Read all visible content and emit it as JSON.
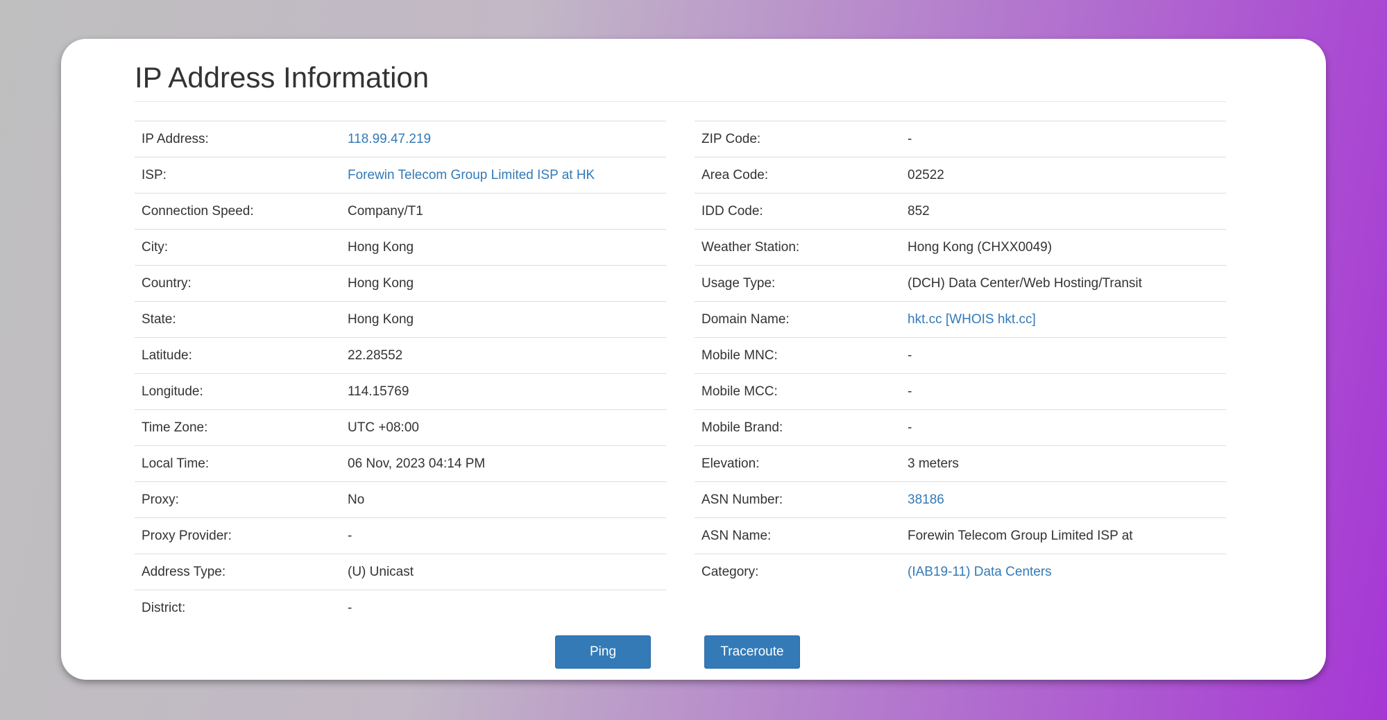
{
  "title": "IP Address Information",
  "left_rows": [
    {
      "label": "IP Address:",
      "value": "118.99.47.219",
      "link": true
    },
    {
      "label": "ISP:",
      "value": "Forewin Telecom Group Limited ISP at HK",
      "link": true
    },
    {
      "label": "Connection Speed:",
      "value": "Company/T1",
      "link": false
    },
    {
      "label": "City:",
      "value": "Hong Kong",
      "link": false
    },
    {
      "label": "Country:",
      "value": "Hong Kong",
      "link": false
    },
    {
      "label": "State:",
      "value": "Hong Kong",
      "link": false
    },
    {
      "label": "Latitude:",
      "value": "22.28552",
      "link": false
    },
    {
      "label": "Longitude:",
      "value": "114.15769",
      "link": false
    },
    {
      "label": "Time Zone:",
      "value": "UTC +08:00",
      "link": false
    },
    {
      "label": "Local Time:",
      "value": "06 Nov, 2023 04:14 PM",
      "link": false
    },
    {
      "label": "Proxy:",
      "value": "No",
      "link": false
    },
    {
      "label": "Proxy Provider:",
      "value": "-",
      "link": false
    },
    {
      "label": "Address Type:",
      "value": "(U) Unicast",
      "link": false
    },
    {
      "label": "District:",
      "value": "-",
      "link": false
    }
  ],
  "right_rows": [
    {
      "label": "ZIP Code:",
      "value": "-",
      "link": false
    },
    {
      "label": "Area Code:",
      "value": "02522",
      "link": false
    },
    {
      "label": "IDD Code:",
      "value": "852",
      "link": false
    },
    {
      "label": "Weather Station:",
      "value": "Hong Kong (CHXX0049)",
      "link": false
    },
    {
      "label": "Usage Type:",
      "value": "(DCH) Data Center/Web Hosting/Transit",
      "link": false
    },
    {
      "label": "Domain Name:",
      "value": "hkt.cc [WHOIS hkt.cc]",
      "link": true
    },
    {
      "label": "Mobile MNC:",
      "value": "-",
      "link": false
    },
    {
      "label": "Mobile MCC:",
      "value": "-",
      "link": false
    },
    {
      "label": "Mobile Brand:",
      "value": "-",
      "link": false
    },
    {
      "label": "Elevation:",
      "value": "3 meters",
      "link": false
    },
    {
      "label": "ASN Number:",
      "value": "38186",
      "link": true
    },
    {
      "label": "ASN Name:",
      "value": "Forewin Telecom Group Limited ISP at",
      "link": false
    },
    {
      "label": "Category:",
      "value": "(IAB19-11) Data Centers",
      "link": true
    }
  ],
  "buttons": {
    "ping": "Ping",
    "traceroute": "Traceroute"
  },
  "colors": {
    "link": "#337ab7",
    "button": "#337ab7"
  }
}
